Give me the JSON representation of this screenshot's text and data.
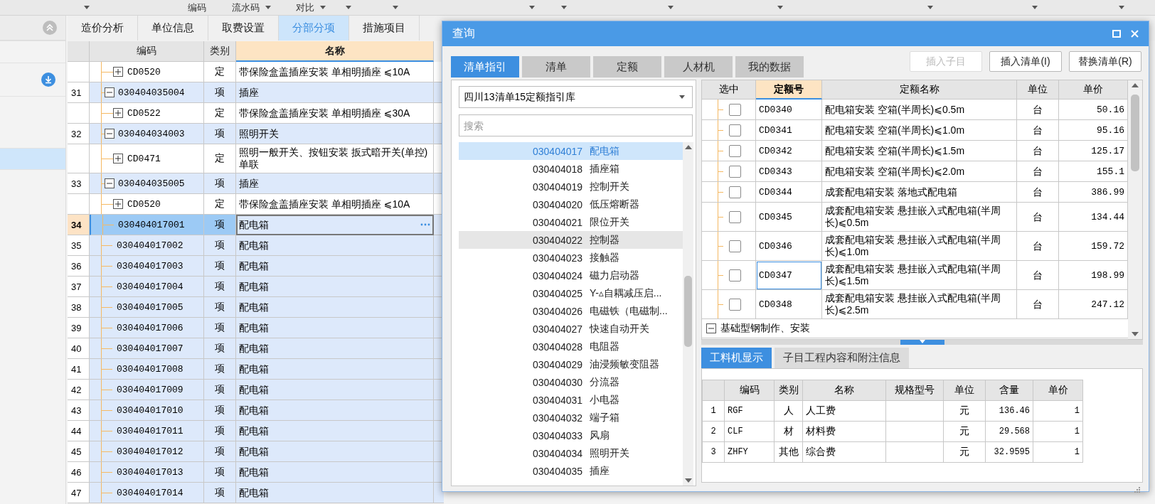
{
  "toolbar": {
    "items": [
      {
        "dropdown": true
      },
      {
        "label": "编码",
        "dropdown": false
      },
      {
        "label": "流水码",
        "dropdown": true
      },
      {
        "label": "对比",
        "dropdown": true
      },
      {
        "dropdown": true
      },
      {
        "dropdown": true
      },
      {
        "dropdown": true
      },
      {
        "dropdown": true
      },
      {
        "dropdown": true
      },
      {
        "dropdown": true
      },
      {
        "dropdown": true
      },
      {
        "dropdown": true
      },
      {
        "dropdown": true
      }
    ]
  },
  "sidebar": {
    "items": [
      {
        "selected": false
      },
      {
        "selected": true
      }
    ]
  },
  "page_tabs": [
    {
      "label": "造价分析",
      "selected": false
    },
    {
      "label": "单位信息",
      "selected": false
    },
    {
      "label": "取费设置",
      "selected": false
    },
    {
      "label": "分部分项",
      "selected": true
    },
    {
      "label": "措施项目",
      "selected": false
    }
  ],
  "table": {
    "columns": [
      {
        "label": "编码",
        "selected": false
      },
      {
        "label": "类别",
        "selected": false
      },
      {
        "label": "名称",
        "selected": true
      }
    ],
    "rows": [
      {
        "kind": "quota",
        "expanded": false,
        "code": "CD0520",
        "type": "定",
        "name": "带保险盒盖插座安装 单相明插座 ⩽10A",
        "selected": false
      },
      {
        "number": "31",
        "kind": "group",
        "expanded": true,
        "code": "030404035004",
        "type": "项",
        "name": "插座",
        "selected": false
      },
      {
        "kind": "quota",
        "expanded": false,
        "code": "CD0522",
        "type": "定",
        "name": "带保险盒盖插座安装 单相明插座 ⩽30A",
        "selected": false
      },
      {
        "number": "32",
        "kind": "group",
        "expanded": true,
        "code": "030404034003",
        "type": "项",
        "name": "照明开关",
        "selected": false
      },
      {
        "kind": "quota",
        "expanded": false,
        "code": "CD0471",
        "type": "定",
        "name": "照明一般开关、按钮安装 扳式暗开关(单控)单联",
        "selected": false
      },
      {
        "number": "33",
        "kind": "group",
        "expanded": true,
        "code": "030404035005",
        "type": "项",
        "name": "插座",
        "selected": false
      },
      {
        "kind": "quota",
        "expanded": false,
        "code": "CD0520",
        "type": "定",
        "name": "带保险盒盖插座安装 单相明插座 ⩽10A",
        "selected": false
      },
      {
        "number": "34",
        "kind": "leaf",
        "code": "030404017001",
        "type": "项",
        "name": "配电箱",
        "selected": true
      },
      {
        "number": "35",
        "kind": "leaf",
        "code": "030404017002",
        "type": "项",
        "name": "配电箱",
        "selected": false
      },
      {
        "number": "36",
        "kind": "leaf",
        "code": "030404017003",
        "type": "项",
        "name": "配电箱",
        "selected": false
      },
      {
        "number": "37",
        "kind": "leaf",
        "code": "030404017004",
        "type": "项",
        "name": "配电箱",
        "selected": false
      },
      {
        "number": "38",
        "kind": "leaf",
        "code": "030404017005",
        "type": "项",
        "name": "配电箱",
        "selected": false
      },
      {
        "number": "39",
        "kind": "leaf",
        "code": "030404017006",
        "type": "项",
        "name": "配电箱",
        "selected": false
      },
      {
        "number": "40",
        "kind": "leaf",
        "code": "030404017007",
        "type": "项",
        "name": "配电箱",
        "selected": false
      },
      {
        "number": "41",
        "kind": "leaf",
        "code": "030404017008",
        "type": "项",
        "name": "配电箱",
        "selected": false
      },
      {
        "number": "42",
        "kind": "leaf",
        "code": "030404017009",
        "type": "项",
        "name": "配电箱",
        "selected": false
      },
      {
        "number": "43",
        "kind": "leaf",
        "code": "030404017010",
        "type": "项",
        "name": "配电箱",
        "selected": false
      },
      {
        "number": "44",
        "kind": "leaf",
        "code": "030404017011",
        "type": "项",
        "name": "配电箱",
        "selected": false
      },
      {
        "number": "45",
        "kind": "leaf",
        "code": "030404017012",
        "type": "项",
        "name": "配电箱",
        "selected": false
      },
      {
        "number": "46",
        "kind": "leaf",
        "code": "030404017013",
        "type": "项",
        "name": "配电箱",
        "selected": false
      },
      {
        "number": "47",
        "kind": "leaf",
        "code": "030404017014",
        "type": "项",
        "name": "配电箱",
        "selected": false
      }
    ]
  },
  "dialog": {
    "title": "查询",
    "tabs": [
      {
        "label": "清单指引",
        "selected": true
      },
      {
        "label": "清单",
        "selected": false
      },
      {
        "label": "定额",
        "selected": false
      },
      {
        "label": "人材机",
        "selected": false
      },
      {
        "label": "我的数据",
        "selected": false
      }
    ],
    "buttons": [
      {
        "label": "插入子目",
        "disabled": true
      },
      {
        "label": "插入清单(I)",
        "disabled": false
      },
      {
        "label": "替换清单(R)",
        "disabled": false
      }
    ],
    "library": {
      "value": "四川13清单15定额指引库"
    },
    "search": {
      "placeholder": "搜索"
    },
    "list": [
      {
        "code": "030404017",
        "name": "配电箱",
        "selected": true,
        "hovered": false
      },
      {
        "code": "030404018",
        "name": "插座箱",
        "selected": false,
        "hovered": false
      },
      {
        "code": "030404019",
        "name": "控制开关",
        "selected": false,
        "hovered": false
      },
      {
        "code": "030404020",
        "name": "低压熔断器",
        "selected": false,
        "hovered": false
      },
      {
        "code": "030404021",
        "name": "限位开关",
        "selected": false,
        "hovered": false
      },
      {
        "code": "030404022",
        "name": "控制器",
        "selected": false,
        "hovered": true
      },
      {
        "code": "030404023",
        "name": "接触器",
        "selected": false,
        "hovered": false
      },
      {
        "code": "030404024",
        "name": "磁力启动器",
        "selected": false,
        "hovered": false
      },
      {
        "code": "030404025",
        "name": "Y-▵自耦减压启...",
        "selected": false,
        "hovered": false
      },
      {
        "code": "030404026",
        "name": "电磁铁（电磁制...",
        "selected": false,
        "hovered": false
      },
      {
        "code": "030404027",
        "name": "快速自动开关",
        "selected": false,
        "hovered": false
      },
      {
        "code": "030404028",
        "name": "电阻器",
        "selected": false,
        "hovered": false
      },
      {
        "code": "030404029",
        "name": "油浸频敏变阻器",
        "selected": false,
        "hovered": false
      },
      {
        "code": "030404030",
        "name": "分流器",
        "selected": false,
        "hovered": false
      },
      {
        "code": "030404031",
        "name": "小电器",
        "selected": false,
        "hovered": false
      },
      {
        "code": "030404032",
        "name": "端子箱",
        "selected": false,
        "hovered": false
      },
      {
        "code": "030404033",
        "name": "风扇",
        "selected": false,
        "hovered": false
      },
      {
        "code": "030404034",
        "name": "照明开关",
        "selected": false,
        "hovered": false
      },
      {
        "code": "030404035",
        "name": "插座",
        "selected": false,
        "hovered": false
      }
    ],
    "quota_table": {
      "columns": [
        {
          "label": "选中",
          "selected": false
        },
        {
          "label": "定额号",
          "selected": true
        },
        {
          "label": "定额名称",
          "selected": false
        },
        {
          "label": "单位",
          "selected": false
        },
        {
          "label": "单价",
          "selected": false
        }
      ],
      "rows": [
        {
          "checked": false,
          "code": "CD0340",
          "name": "配电箱安装 空箱(半周长)⩽0.5m",
          "unit": "台",
          "price": "50.16",
          "selected": false
        },
        {
          "checked": false,
          "code": "CD0341",
          "name": "配电箱安装 空箱(半周长)⩽1.0m",
          "unit": "台",
          "price": "95.16",
          "selected": false
        },
        {
          "checked": false,
          "code": "CD0342",
          "name": "配电箱安装 空箱(半周长)⩽1.5m",
          "unit": "台",
          "price": "125.17",
          "selected": false
        },
        {
          "checked": false,
          "code": "CD0343",
          "name": "配电箱安装 空箱(半周长)⩽2.0m",
          "unit": "台",
          "price": "155.1",
          "selected": false
        },
        {
          "checked": false,
          "code": "CD0344",
          "name": "成套配电箱安装 落地式配电箱",
          "unit": "台",
          "price": "386.99",
          "selected": false
        },
        {
          "checked": false,
          "code": "CD0345",
          "name": "成套配电箱安装 悬挂嵌入式配电箱(半周长)⩽0.5m",
          "unit": "台",
          "price": "134.44",
          "selected": false
        },
        {
          "checked": false,
          "code": "CD0346",
          "name": "成套配电箱安装 悬挂嵌入式配电箱(半周长)⩽1.0m",
          "unit": "台",
          "price": "159.72",
          "selected": false
        },
        {
          "checked": false,
          "code": "CD0347",
          "name": "成套配电箱安装 悬挂嵌入式配电箱(半周长)⩽1.5m",
          "unit": "台",
          "price": "198.99",
          "selected": true
        },
        {
          "checked": false,
          "code": "CD0348",
          "name": "成套配电箱安装 悬挂嵌入式配电箱(半周长)⩽2.5m",
          "unit": "台",
          "price": "247.12",
          "selected": false
        }
      ],
      "group": {
        "label": "基础型钢制作、安装",
        "expanded": true
      }
    },
    "detail_tabs": [
      {
        "label": "工料机显示",
        "selected": true
      },
      {
        "label": "子目工程内容和附注信息",
        "selected": false
      }
    ],
    "detail_table": {
      "columns": [
        "编码",
        "类别",
        "名称",
        "规格型号",
        "单位",
        "含量",
        "单价"
      ],
      "rows": [
        {
          "number": "1",
          "code": "RGF",
          "type": "人",
          "name": "人工费",
          "unit": "元",
          "amount": "136.46",
          "price": "1"
        },
        {
          "number": "2",
          "code": "CLF",
          "type": "材",
          "name": "材料费",
          "unit": "元",
          "amount": "29.568",
          "price": "1"
        },
        {
          "number": "3",
          "code": "ZHFY",
          "type": "其他",
          "name": "综合费",
          "unit": "元",
          "amount": "32.9595",
          "price": "1"
        }
      ]
    }
  }
}
